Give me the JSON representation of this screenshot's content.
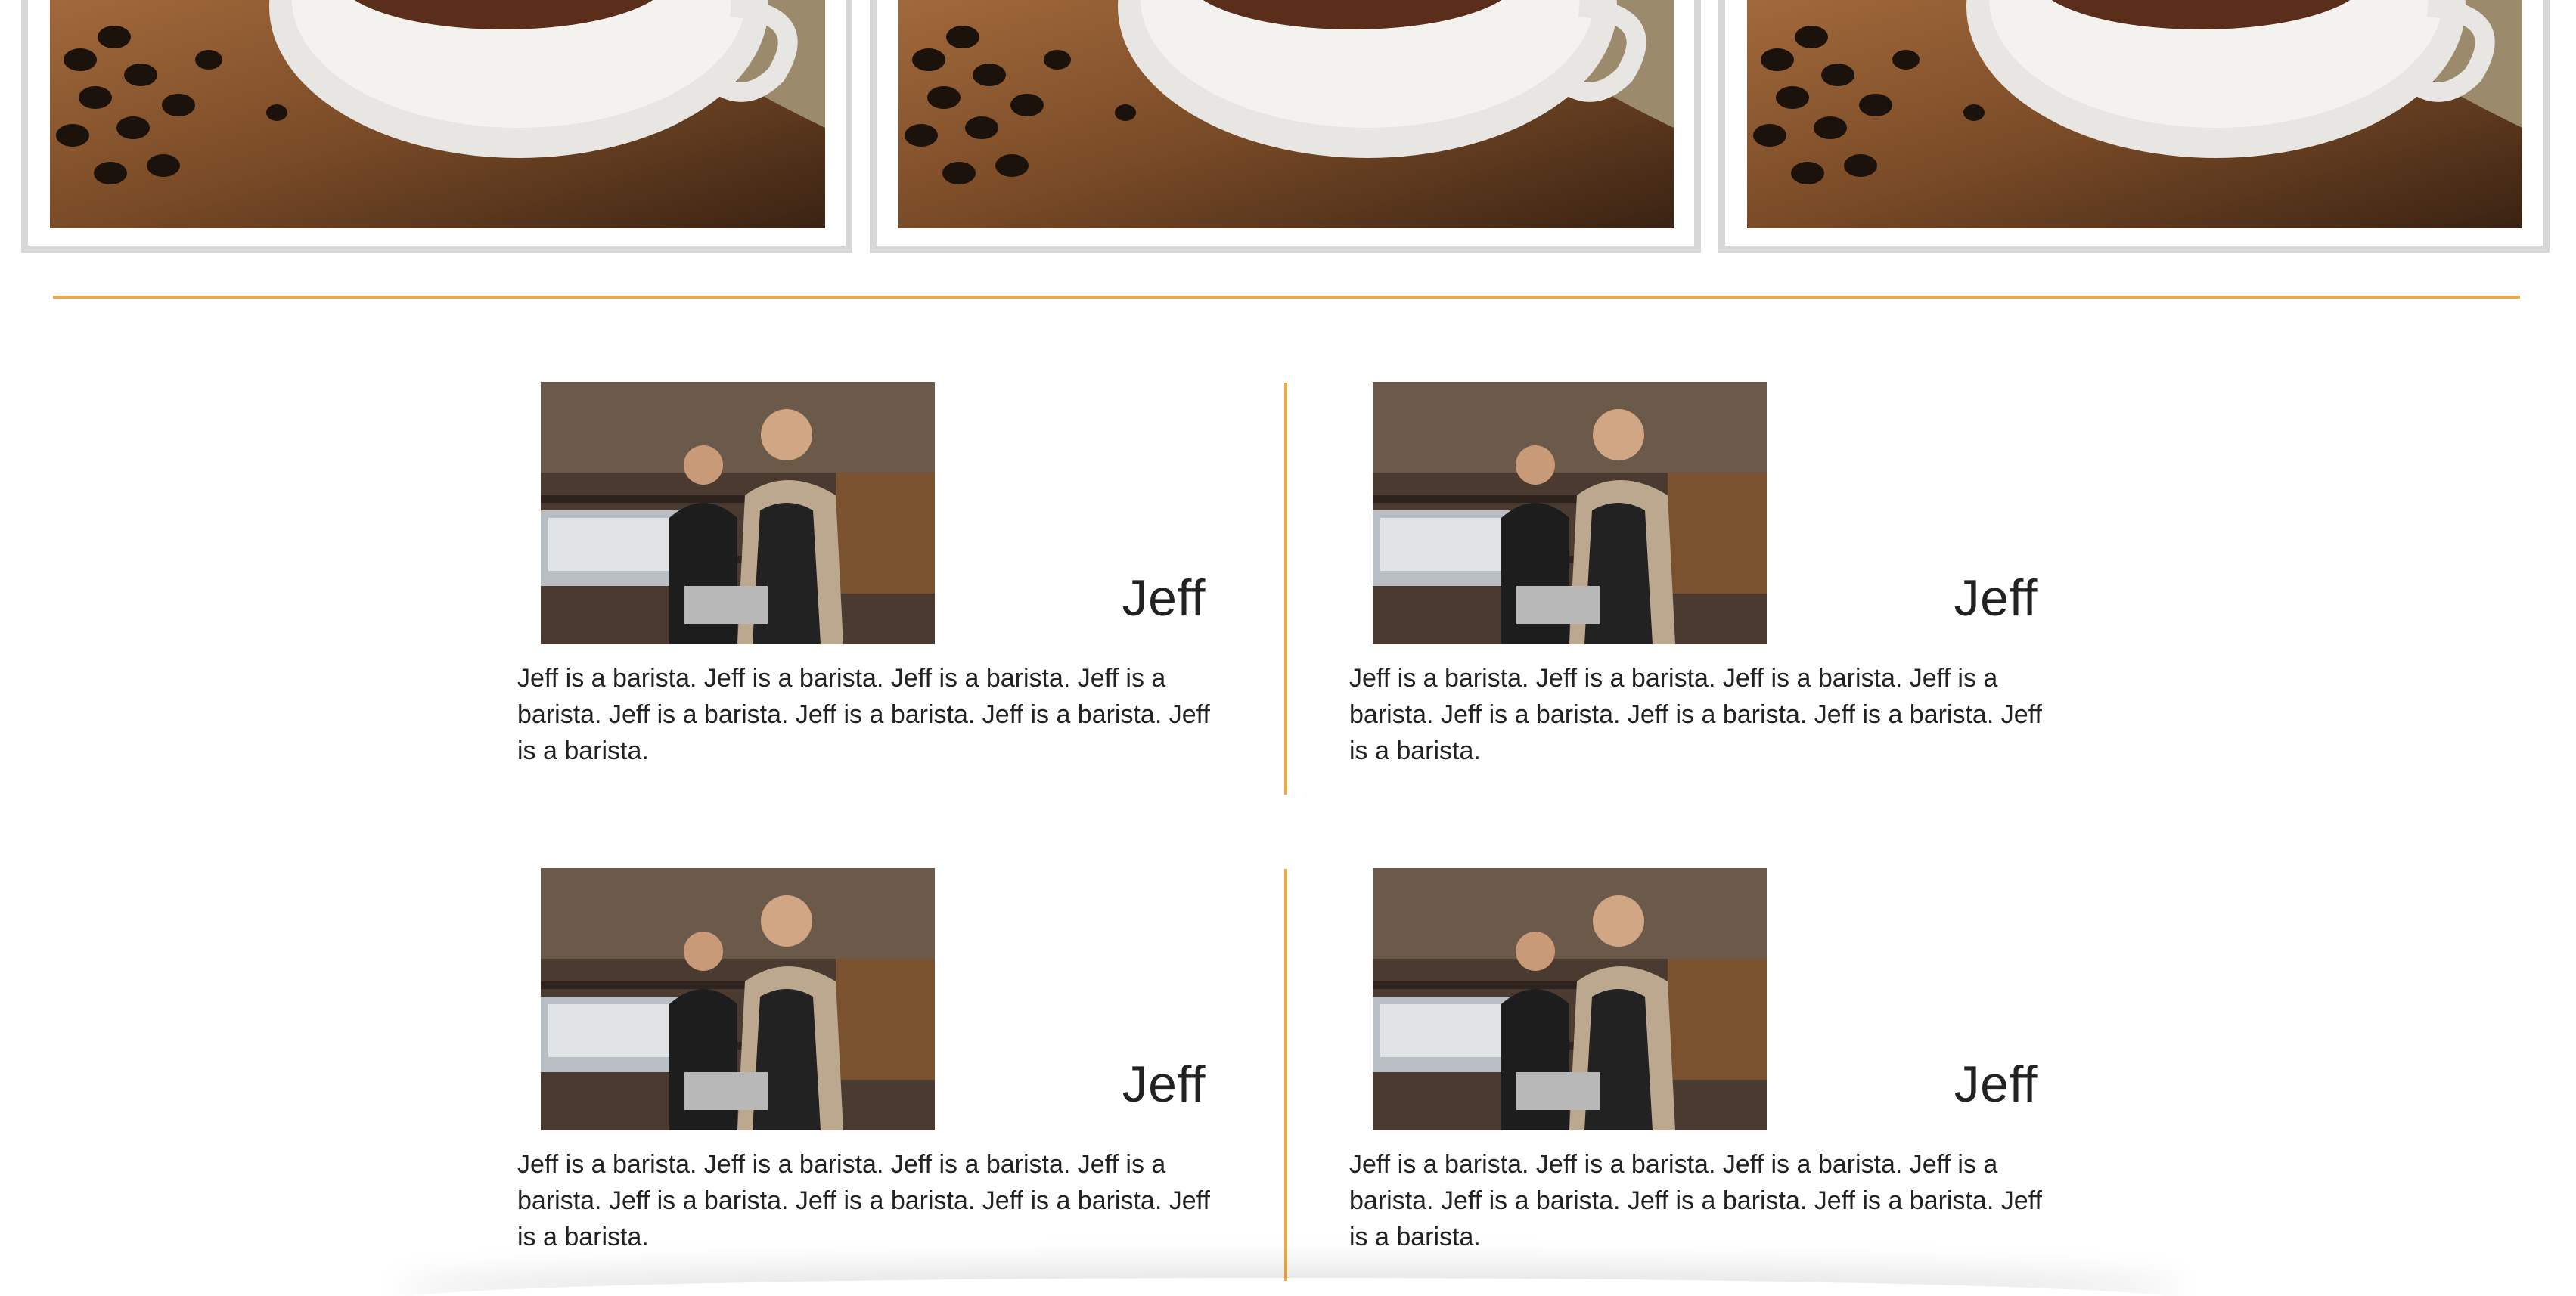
{
  "gallery": {
    "items": [
      {
        "image": "coffee-cup-image"
      },
      {
        "image": "coffee-cup-image"
      },
      {
        "image": "coffee-cup-image"
      }
    ]
  },
  "colors": {
    "accent": "#f0a845",
    "card_border": "#d7d7d7",
    "text": "#222222"
  },
  "staff": [
    {
      "name": "Jeff",
      "bio": "Jeff is a barista. Jeff is a barista. Jeff is a barista. Jeff is a barista. Jeff is a barista. Jeff is a barista. Jeff is a barista. Jeff is a barista.",
      "image": "baristas-photo"
    },
    {
      "name": "Jeff",
      "bio": "Jeff is a barista. Jeff is a barista. Jeff is a barista. Jeff is a barista. Jeff is a barista. Jeff is a barista. Jeff is a barista. Jeff is a barista.",
      "image": "baristas-photo"
    },
    {
      "name": "Jeff",
      "bio": "Jeff is a barista. Jeff is a barista. Jeff is a barista. Jeff is a barista. Jeff is a barista. Jeff is a barista. Jeff is a barista. Jeff is a barista.",
      "image": "baristas-photo"
    },
    {
      "name": "Jeff",
      "bio": "Jeff is a barista. Jeff is a barista. Jeff is a barista. Jeff is a barista. Jeff is a barista. Jeff is a barista. Jeff is a barista. Jeff is a barista.",
      "image": "baristas-photo"
    }
  ]
}
